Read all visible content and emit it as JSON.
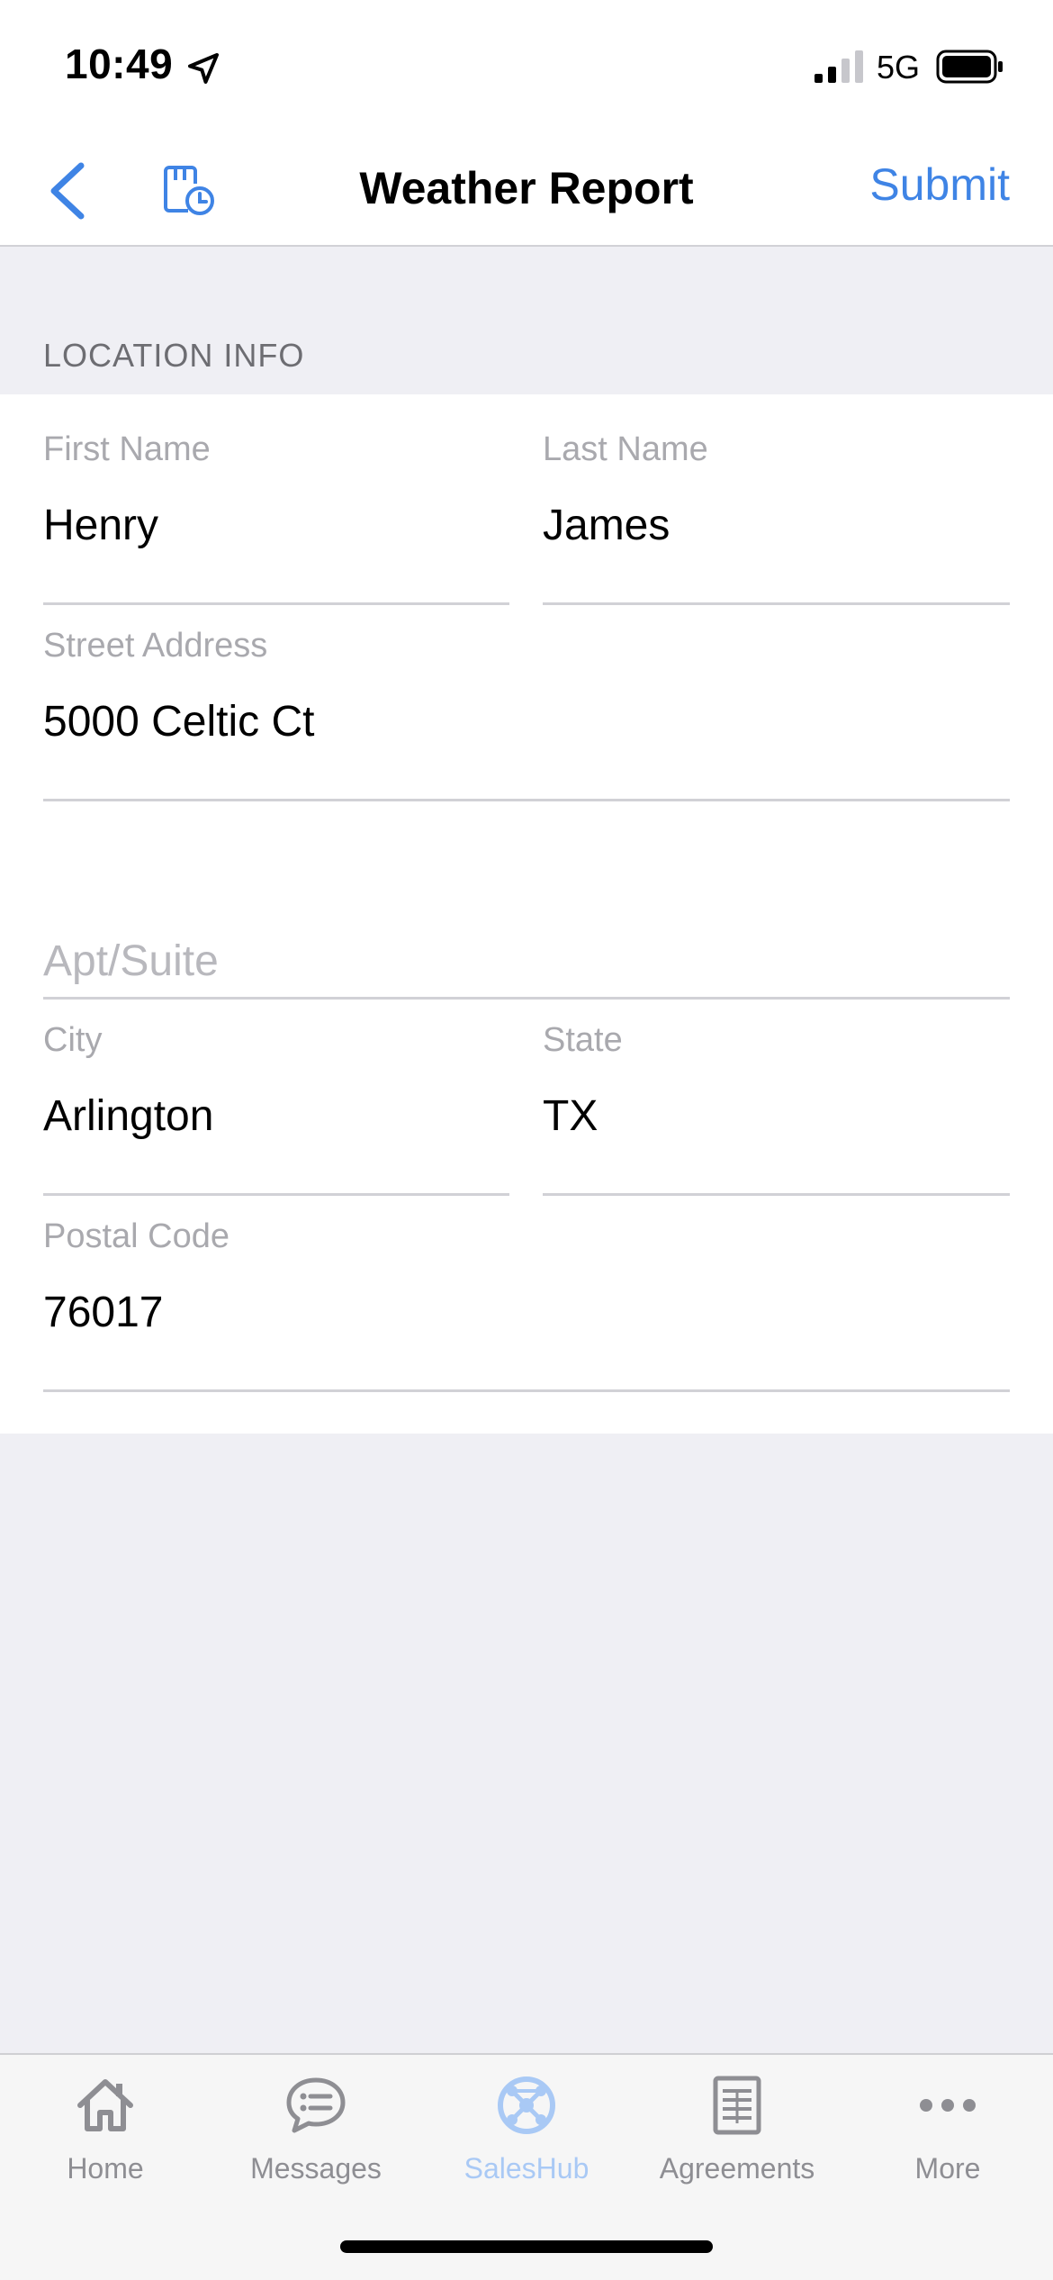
{
  "status_bar": {
    "time": "10:49",
    "network": "5G"
  },
  "nav": {
    "title": "Weather Report",
    "submit_label": "Submit"
  },
  "section": {
    "header": "LOCATION INFO"
  },
  "form": {
    "first_name": {
      "label": "First Name",
      "value": "Henry"
    },
    "last_name": {
      "label": "Last Name",
      "value": "James"
    },
    "street_address": {
      "label": "Street Address",
      "value": "5000 Celtic Ct"
    },
    "apt_suite": {
      "placeholder": "Apt/Suite",
      "value": ""
    },
    "city": {
      "label": "City",
      "value": "Arlington"
    },
    "state": {
      "label": "State",
      "value": "TX"
    },
    "postal_code": {
      "label": "Postal Code",
      "value": "76017"
    }
  },
  "tab_bar": {
    "items": [
      {
        "label": "Home",
        "icon": "home-icon",
        "active": false
      },
      {
        "label": "Messages",
        "icon": "messages-icon",
        "active": false
      },
      {
        "label": "SalesHub",
        "icon": "saleshub-icon",
        "active": true
      },
      {
        "label": "Agreements",
        "icon": "agreements-icon",
        "active": false
      },
      {
        "label": "More",
        "icon": "more-icon",
        "active": false
      }
    ]
  },
  "colors": {
    "accent": "#3f84e5",
    "tab_active": "#a9c9f5",
    "tab_inactive": "#8e8e93",
    "background": "#efeff4"
  }
}
